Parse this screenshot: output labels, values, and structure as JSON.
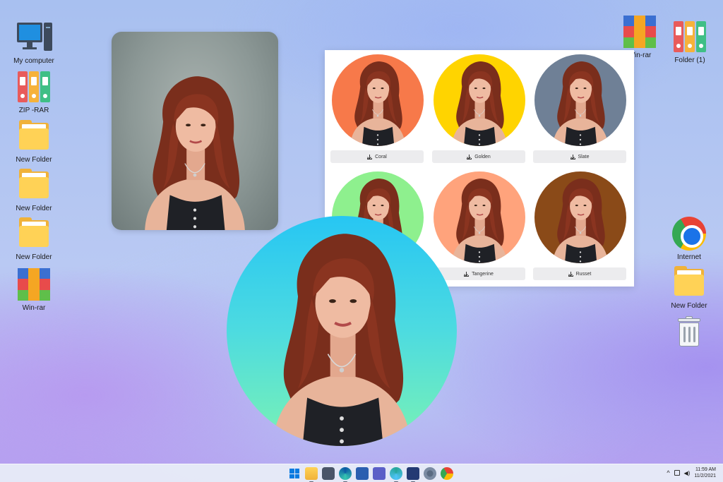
{
  "desktop_left": [
    {
      "label": "My computer",
      "icon": "computer-icon"
    },
    {
      "label": "ZIP -RAR",
      "icon": "binders-icon"
    },
    {
      "label": "New Folder",
      "icon": "folder-icon"
    },
    {
      "label": "New Folder",
      "icon": "folder-icon"
    },
    {
      "label": "New Folder",
      "icon": "folder-icon"
    },
    {
      "label": "Win-rar",
      "icon": "winrar-icon"
    }
  ],
  "desktop_right": [
    {
      "label": "Win-rar",
      "icon": "winrar-icon"
    },
    {
      "label": "Folder (1)",
      "icon": "binders-icon"
    },
    {
      "label": "Internet",
      "icon": "chrome-icon"
    },
    {
      "label": "New Folder",
      "icon": "folder-icon"
    },
    {
      "label": "",
      "icon": "recycle-bin-icon"
    }
  ],
  "variants": [
    {
      "label": "Coral",
      "color": "#f7794a"
    },
    {
      "label": "Golden",
      "color": "#ffd400"
    },
    {
      "label": "Slate",
      "color": "#6f8096"
    },
    {
      "label": "",
      "color": "#8ef08e"
    },
    {
      "label": "Tangerine",
      "color": "#ffa37c"
    },
    {
      "label": "Russet",
      "color": "#8a4a18"
    }
  ],
  "taskbar": {
    "apps": [
      "start-icon",
      "file-explorer-icon",
      "camera-icon",
      "edge-icon",
      "store-icon",
      "teams-icon",
      "paint-icon",
      "app-icon",
      "settings-icon",
      "chrome-icon"
    ],
    "time": "11:59 AM",
    "date": "11/2/2021"
  },
  "colors": {
    "big_circle_top": "#27c6f3",
    "big_circle_bottom": "#7af2b4",
    "photo_background": "#8c9896"
  }
}
